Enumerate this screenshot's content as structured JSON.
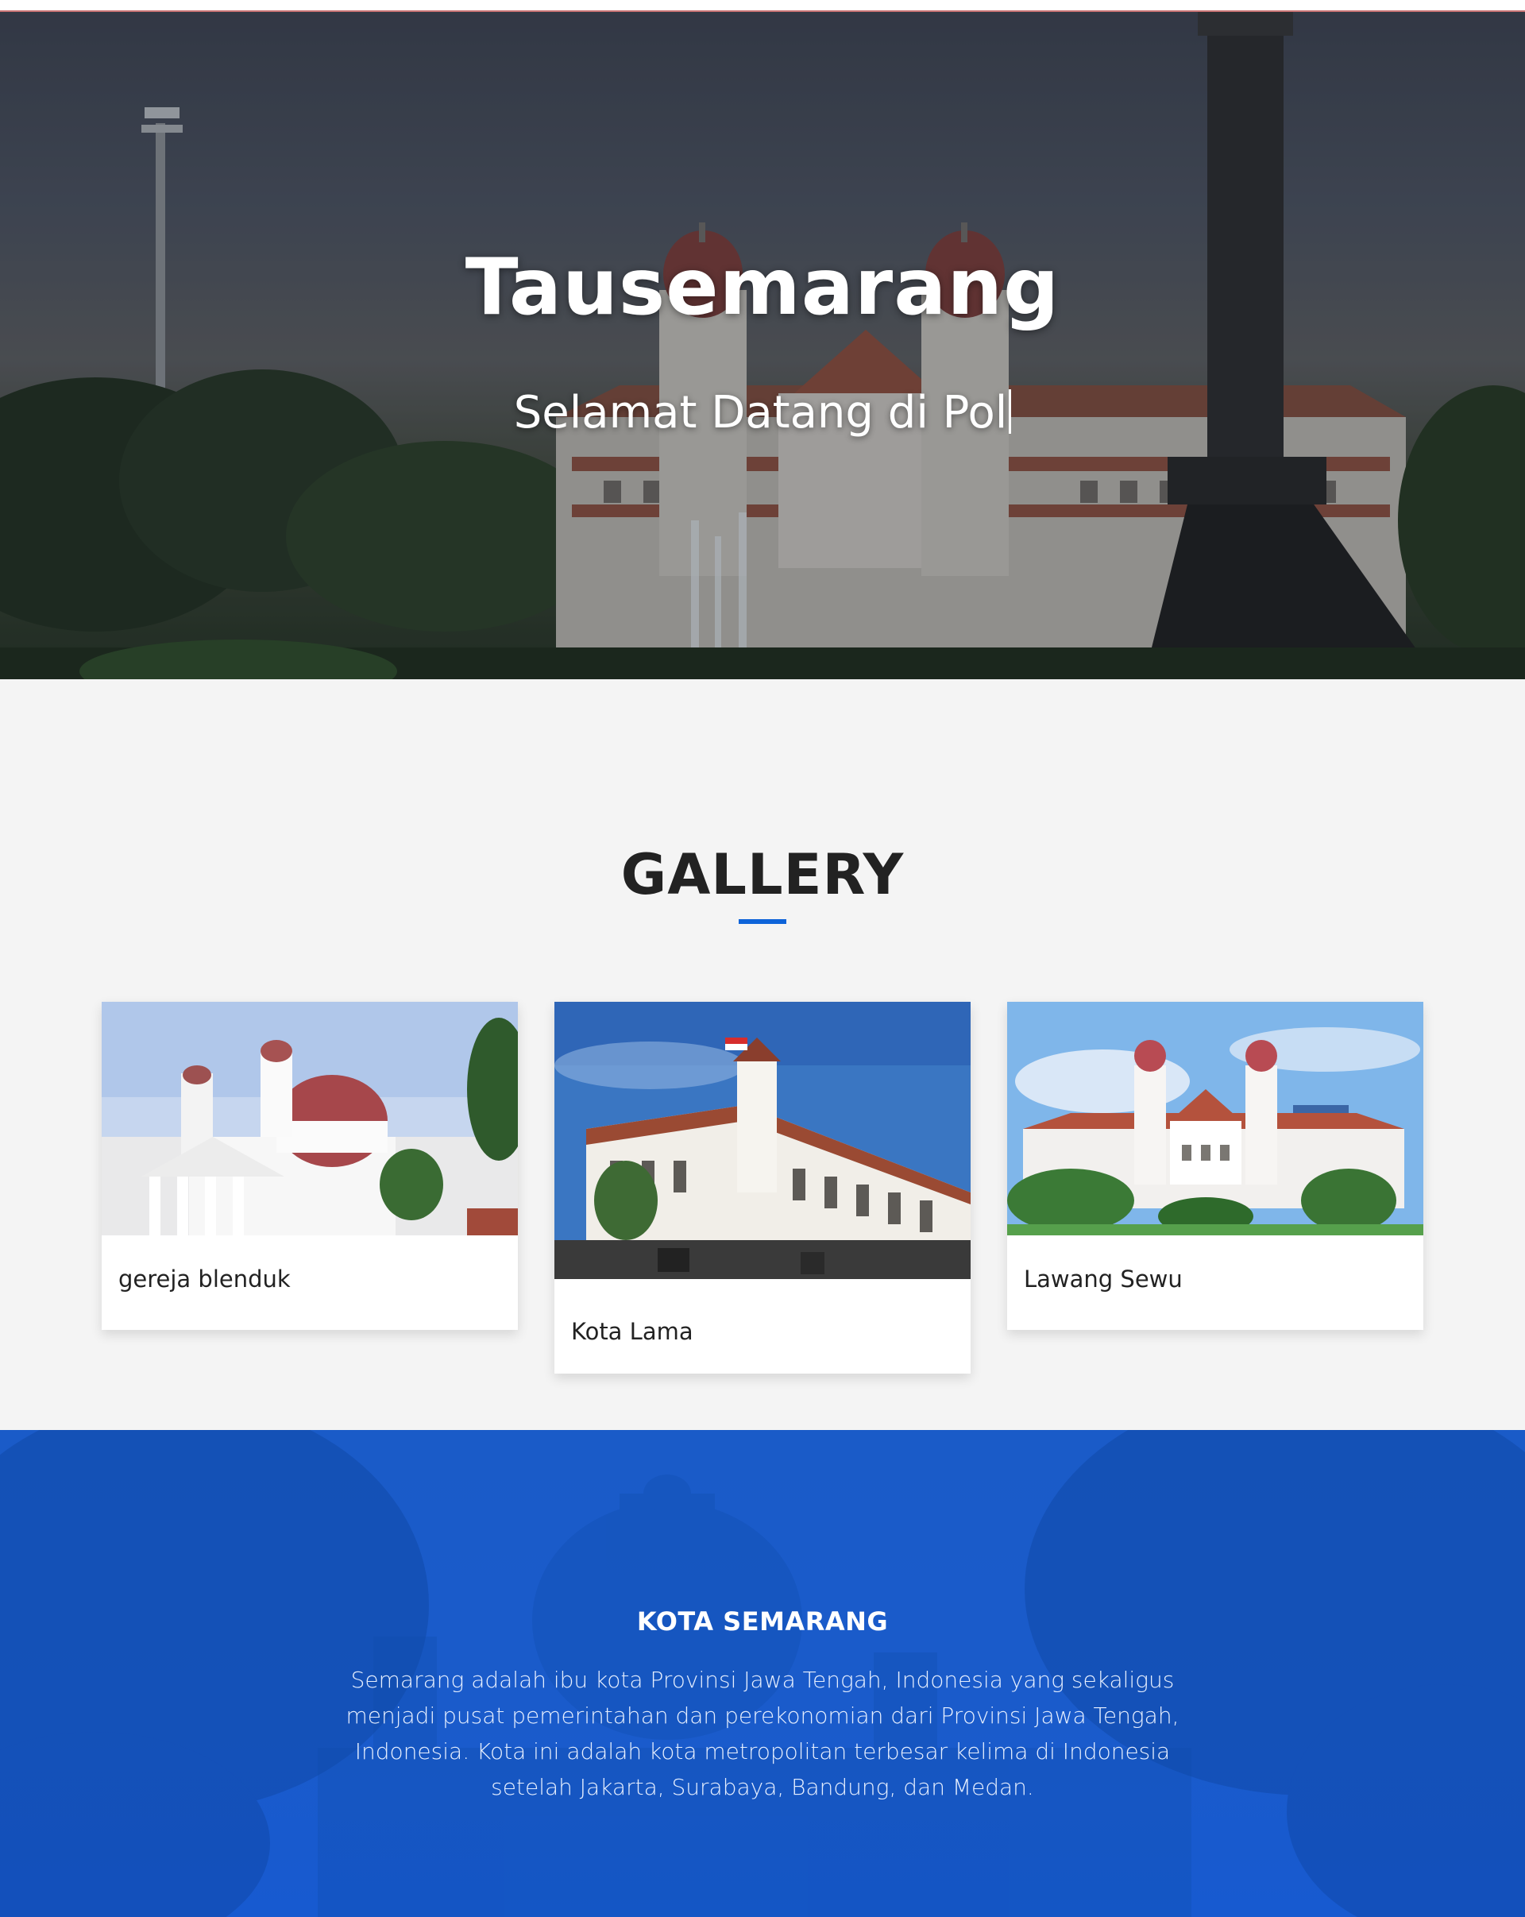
{
  "hero": {
    "title": "Tausemarang",
    "subtitle": "Selamat Datang di Pol",
    "overlay_color": "#191e2d"
  },
  "gallery": {
    "heading": "GALLERY",
    "accent_color": "#0d63d9",
    "items": [
      {
        "caption": "gereja blenduk",
        "image": "church-dome-photo"
      },
      {
        "caption": "Kota Lama",
        "image": "old-town-building-photo"
      },
      {
        "caption": "Lawang Sewu",
        "image": "twin-tower-building-photo"
      }
    ]
  },
  "about": {
    "title": "KOTA SEMARANG",
    "text": "Semarang adalah ibu kota Provinsi Jawa Tengah, Indonesia yang sekaligus menjadi pusat pemerintahan dan perekonomian dari Provinsi Jawa Tengah, Indonesia. Kota ini adalah kota metropolitan terbesar kelima di Indonesia setelah Jakarta, Surabaya, Bandung, dan Medan.",
    "background_color": "#1a5bc8"
  }
}
